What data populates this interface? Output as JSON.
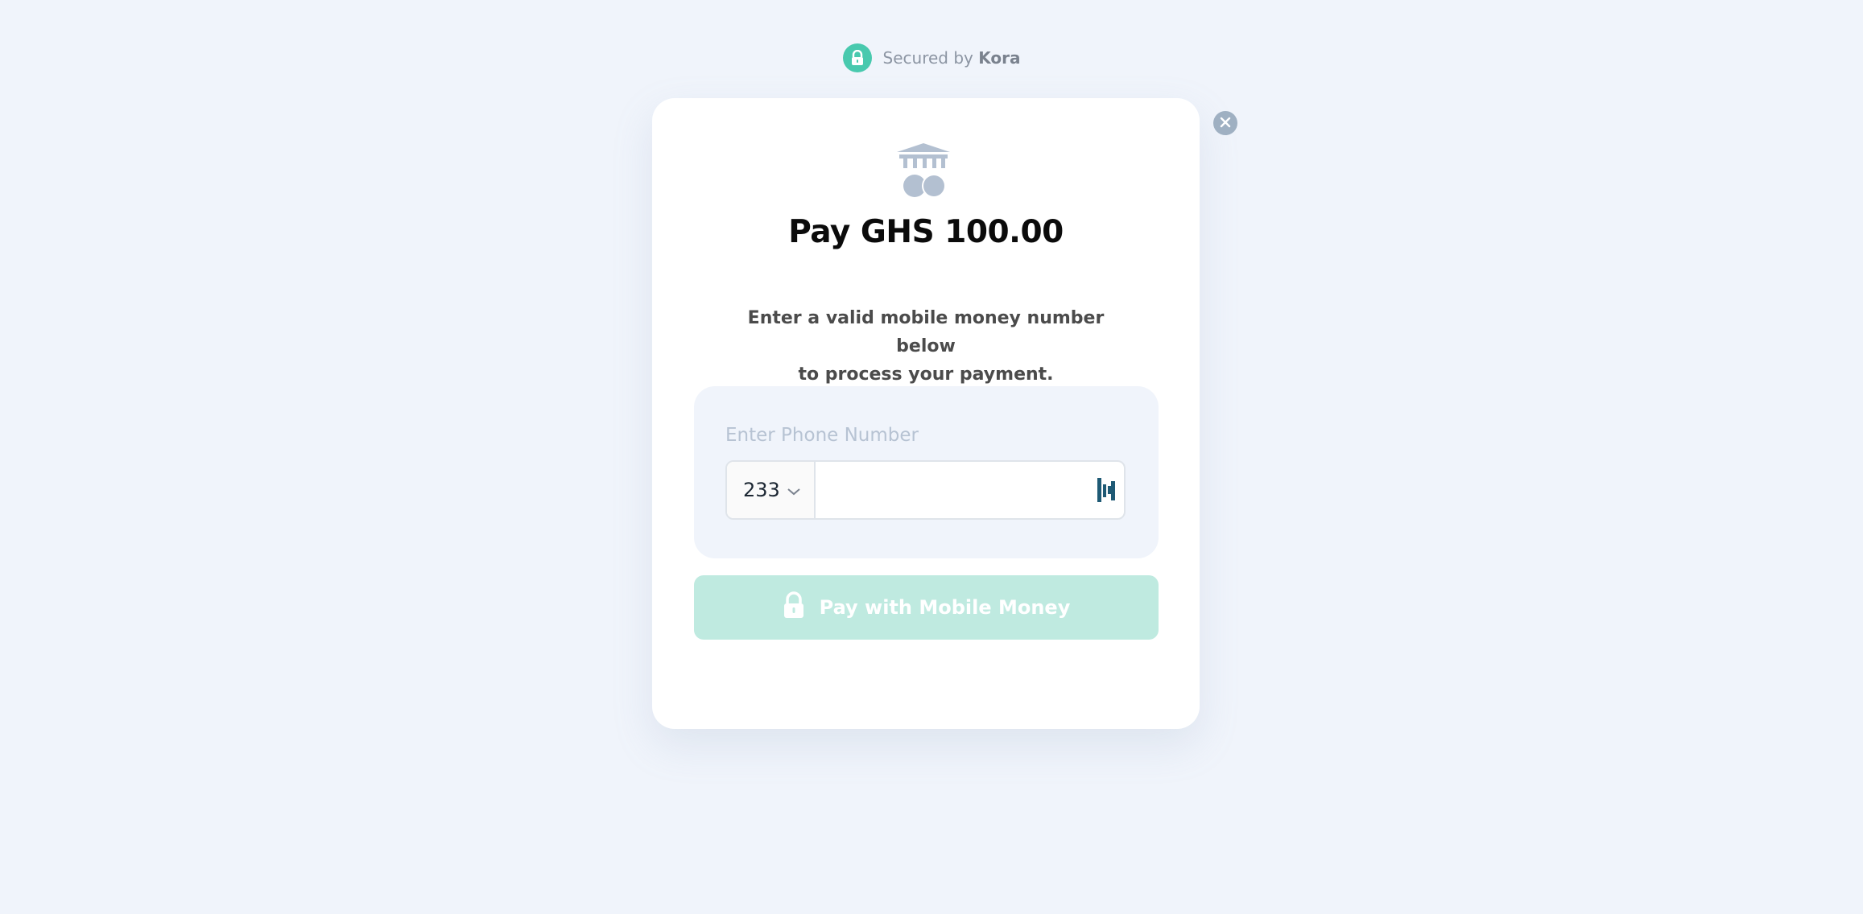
{
  "header": {
    "secured_prefix": "Secured by",
    "brand": "Kora",
    "icon": "lock-icon"
  },
  "modal": {
    "close_icon": "close-icon",
    "bank_icon": "bank-icon",
    "title": "Pay GHS 100.00",
    "instructions_line1": "Enter a valid mobile money number below",
    "instructions_line2": "to process your payment.",
    "phone": {
      "label": "Enter Phone Number",
      "country_code": "233",
      "value": "",
      "addon_icon": "password-manager-icon"
    },
    "submit": {
      "label": "Pay with Mobile Money",
      "icon": "lock-icon"
    }
  },
  "colors": {
    "accent": "#48c9ae",
    "button_disabled": "#bfeae0",
    "background": "#f0f4fb",
    "close": "#9fb0c2",
    "icon_muted": "#b3c0d1"
  }
}
